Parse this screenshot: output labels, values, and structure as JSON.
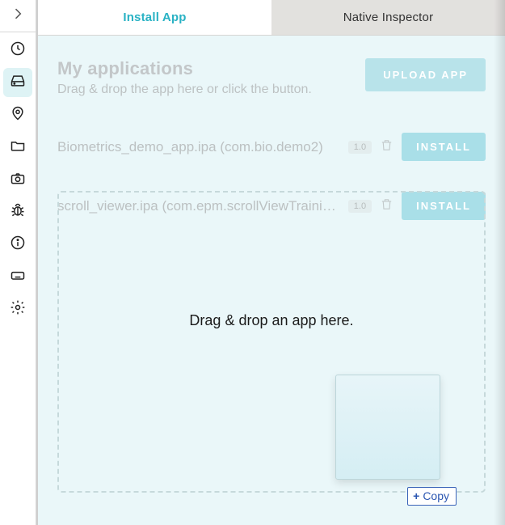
{
  "sidebar": {
    "items": [
      {
        "name": "clock-icon"
      },
      {
        "name": "harddrive-icon"
      },
      {
        "name": "location-icon"
      },
      {
        "name": "folder-icon"
      },
      {
        "name": "camera-icon"
      },
      {
        "name": "bug-icon"
      },
      {
        "name": "info-icon"
      },
      {
        "name": "keyboard-icon"
      },
      {
        "name": "gear-icon"
      }
    ],
    "active_index": 1
  },
  "tabs": {
    "install": "Install App",
    "native": "Native Inspector",
    "active": "install"
  },
  "header": {
    "title": "My applications",
    "subtitle": "Drag & drop the app here or click the button.",
    "upload_label": "UPLOAD APP"
  },
  "apps": [
    {
      "name": "Biometrics_demo_app.ipa (com.bio.demo2)",
      "version": "1.0",
      "install_label": "INSTALL"
    },
    {
      "name": "scroll_viewer.ipa (com.epm.scrollViewTraini…",
      "version": "1.0",
      "install_label": "INSTALL"
    }
  ],
  "dropzone": {
    "text": "Drag & drop an app here."
  },
  "drag": {
    "copy_label": "Copy"
  }
}
